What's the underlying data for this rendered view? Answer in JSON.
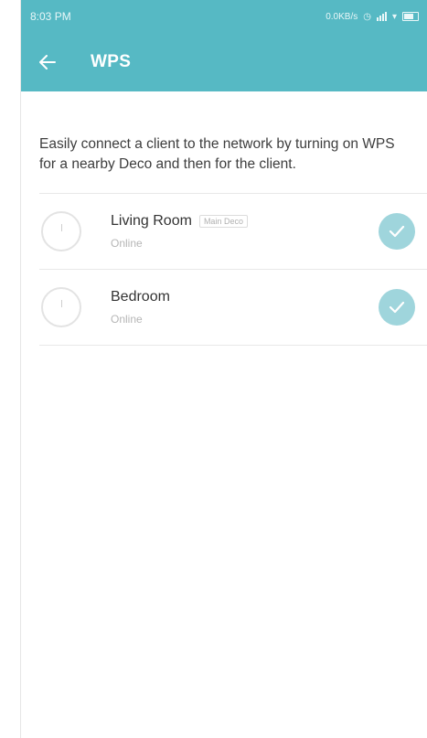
{
  "status_bar": {
    "time": "8:03 PM",
    "net_speed": "0.0KB/s"
  },
  "app_bar": {
    "back_icon": "arrow-left-icon",
    "title": "WPS"
  },
  "description": "Easily connect a client to the network by turning on WPS for a nearby Deco and then for the client.",
  "devices": [
    {
      "name": "Living Room",
      "badge": "Main Deco",
      "status": "Online",
      "checked": true,
      "icon": "deco-icon"
    },
    {
      "name": "Bedroom",
      "badge": "",
      "status": "Online",
      "checked": true,
      "icon": "deco-icon"
    }
  ],
  "colors": {
    "accent": "#56b9c4",
    "check": "#9fd5dc"
  }
}
